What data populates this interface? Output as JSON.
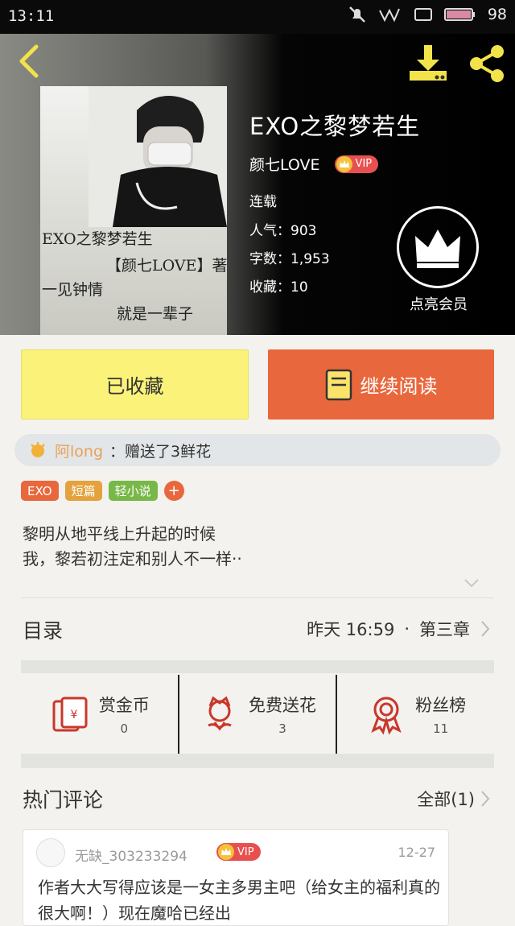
{
  "status_bar": {
    "time": "13:11",
    "battery": "98"
  },
  "book": {
    "title": "EXO之黎梦若生",
    "author": "颜七LOVE",
    "vip_badge": "VIP",
    "status": "连载",
    "popularity": "人气：903",
    "word_count": "字数：1,953",
    "favorites": "收藏：10",
    "cover_lines": [
      "EXO之黎梦若生",
      "【颜七LOVE】著",
      "一见钟情",
      "就是一辈子"
    ]
  },
  "member": {
    "label": "点亮会员"
  },
  "actions": {
    "collected_label": "已收藏",
    "continue_label": "继续阅读"
  },
  "gift": {
    "giver": "阿long",
    "message": "：赠送了3鲜花"
  },
  "tags": [
    {
      "label": "EXO",
      "color": "#e9673c"
    },
    {
      "label": "短篇",
      "color": "#e3a23d"
    },
    {
      "label": "轻小说",
      "color": "#78b849"
    }
  ],
  "description": [
    "黎明从地平线上升起的时候",
    "我，黎若初注定和别人不一样··"
  ],
  "toc": {
    "title": "目录",
    "updated": "昨天 16:59",
    "separator": "·",
    "latest_chapter": "第三章"
  },
  "stats": [
    {
      "label": "赏金币",
      "value": "0"
    },
    {
      "label": "免费送花",
      "value": "3"
    },
    {
      "label": "粉丝榜",
      "value": "11"
    }
  ],
  "hot_comments": {
    "title": "热门评论",
    "all_label": "全部(1)",
    "items": [
      {
        "user": "无缺_303233294",
        "vip": "VIP",
        "date": "12-27",
        "text": "作者大大写得应该是一女主多男主吧（给女主的福利真的很大啊！）现在魔哈已经出"
      }
    ]
  },
  "colors": {
    "accent": "#e9673c",
    "collected_bg": "#fbf27a",
    "vip": "#e8504f"
  }
}
